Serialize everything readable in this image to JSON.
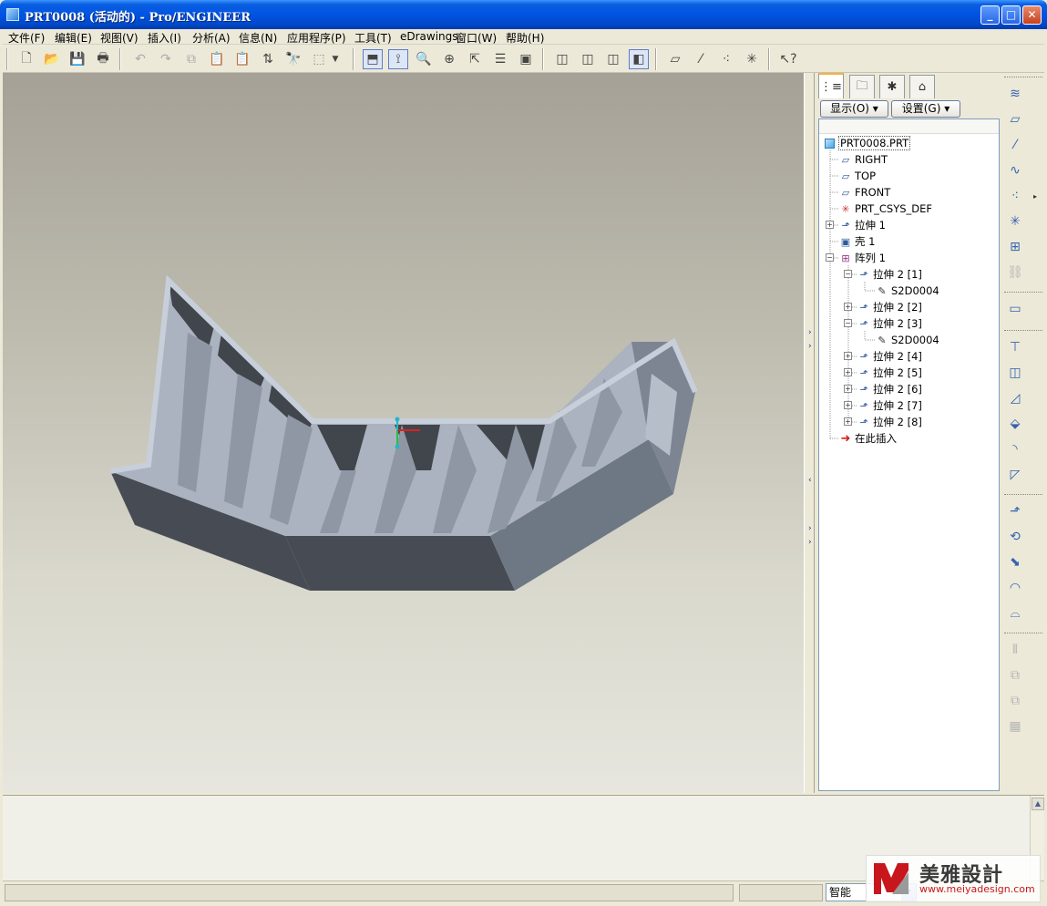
{
  "window": {
    "title": "PRT0008 (活动的) - Pro/ENGINEER",
    "minimize": "_",
    "maximize": "□",
    "close": "✕"
  },
  "menu": [
    "文件(F)",
    "编辑(E)",
    "视图(V)",
    "插入(I)",
    "分析(A)",
    "信息(N)",
    "应用程序(P)",
    "工具(T)",
    "eDrawings",
    "窗口(W)",
    "帮助(H)"
  ],
  "navigator": {
    "show_label": "显示(O) ▾",
    "settings_label": "设置(G) ▾",
    "tree": {
      "root": "PRT0008.PRT",
      "right": "RIGHT",
      "top": "TOP",
      "front": "FRONT",
      "csys": "PRT_CSYS_DEF",
      "extrude1": "拉伸 1",
      "shell1": "壳 1",
      "pattern1": "阵列 1",
      "ext2_1": "拉伸 2 [1]",
      "sketch_a": "S2D0004",
      "ext2_2": "拉伸 2 [2]",
      "ext2_3": "拉伸 2 [3]",
      "sketch_b": "S2D0004",
      "ext2_4": "拉伸 2 [4]",
      "ext2_5": "拉伸 2 [5]",
      "ext2_6": "拉伸 2 [6]",
      "ext2_7": "拉伸 2 [7]",
      "ext2_8": "拉伸 2 [8]",
      "insert_here": "在此插入"
    }
  },
  "status": {
    "filter_value": "智能"
  },
  "watermark": {
    "text": "美雅設計",
    "url": "www.meiyadesign.com"
  }
}
